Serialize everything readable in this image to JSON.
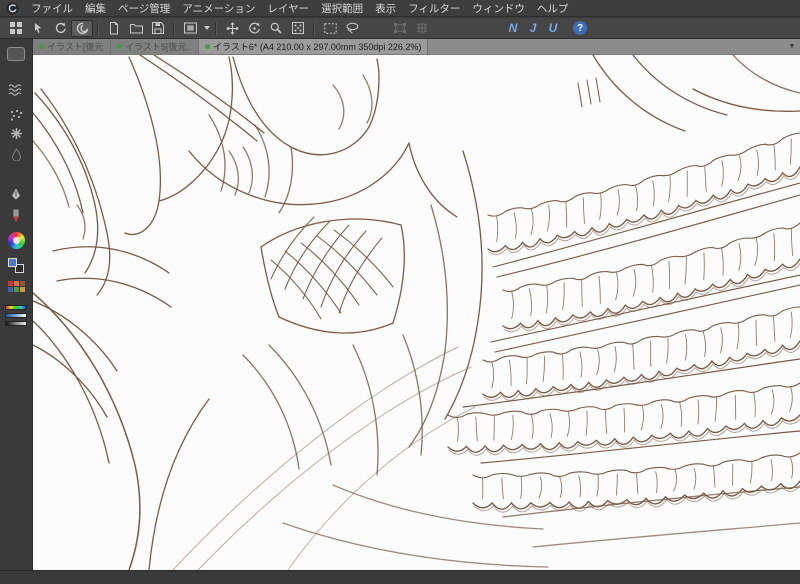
{
  "app": {
    "name": "CLIP STUDIO PAINT"
  },
  "menubar": {
    "items": [
      "ファイル",
      "編集",
      "ページ管理",
      "アニメーション",
      "レイヤー",
      "選択範囲",
      "表示",
      "フィルター",
      "ウィンドウ",
      "ヘルプ"
    ]
  },
  "toolbar": {
    "icon_names": [
      "workspace-grid",
      "object-pointer",
      "rotate-canvas",
      "clipstudio-swirl",
      "new-document",
      "open-document",
      "save-document",
      "canvas-size",
      "dropdown-caret",
      "move-tool",
      "rotate-view",
      "zoom-tool",
      "tone-pattern",
      "marquee-select",
      "lasso-select",
      "scale-transform-disabled",
      "mesh-transform-disabled",
      "ruler-line",
      "ruler-curve",
      "ruler-arc",
      "help"
    ],
    "ruler_glyphs": [
      "N",
      "J",
      "U"
    ],
    "help_glyph": "?"
  },
  "tabbar": {
    "tabs": [
      {
        "label": "イラスト[復元]*",
        "active": false
      },
      {
        "label": "イラスト5[復元...",
        "active": false
      },
      {
        "label": "イラスト6* (A4 210.00 x 297.00mm 350dpi 226.2%)",
        "active": true
      }
    ],
    "overflow_icon": "▼"
  },
  "document": {
    "title": "イラスト6",
    "paper": "A4 210.00 x 297.00mm",
    "resolution": "350dpi",
    "zoom": "226.2%"
  },
  "sidebar": {
    "icon_names": [
      "tool-case",
      "wave-lines",
      "spray-dots",
      "decoration-star",
      "blend-tool",
      "pen-nib",
      "red-marker",
      "color-wheel",
      "color-swatches",
      "color-set",
      "gradient-rainbow",
      "gradient-blue",
      "gradient-gray"
    ]
  },
  "canvas": {
    "content": "brown line-art sketch: character with hair at left, draped fabric folds, lattice netting, and rows of ruffled frills at right",
    "line_color": "#7b5a44",
    "paper_color": "#fcfcfc"
  },
  "colors": {
    "menubar_bg": "#3e3e3e",
    "toolbar_bg": "#464646",
    "tabbar_bg": "#8c8c8c",
    "sidebar_bg": "#3a3a3a",
    "tab_active_bg": "#9b9b9b",
    "tab_inactive_bg": "#7f8080",
    "status_green": "#3f9d3f",
    "accent_blue": "#79a8e6",
    "help_blue": "#3e6db5"
  }
}
